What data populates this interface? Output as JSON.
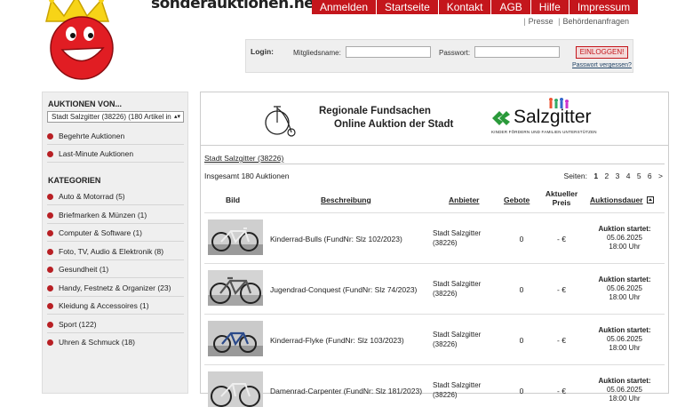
{
  "site": {
    "title": "sonderauktionen.net"
  },
  "nav": [
    {
      "label": "Anmelden"
    },
    {
      "label": "Startseite"
    },
    {
      "label": "Kontakt"
    },
    {
      "label": "AGB"
    },
    {
      "label": "Hilfe"
    },
    {
      "label": "Impressum"
    }
  ],
  "subnav": {
    "presse": "Presse",
    "behoerden": "Behördenanfragen"
  },
  "login": {
    "title": "Login:",
    "member_label": "Mitgliedsname:",
    "password_label": "Passwort:",
    "button": "EINLOGGEN!",
    "forgot": "Passwort vergessen?"
  },
  "sidebar": {
    "auctions_heading": "AUKTIONEN VON...",
    "selected_seller": "Stadt Salzgitter (38226) (180 Artikel in",
    "links": [
      {
        "label": "Begehrte Auktionen"
      },
      {
        "label": "Last-Minute Auktionen"
      }
    ],
    "categories_heading": "KATEGORIEN",
    "categories": [
      {
        "label": "Auto & Motorrad (5)"
      },
      {
        "label": "Briefmarken & Münzen (1)"
      },
      {
        "label": "Computer & Software (1)"
      },
      {
        "label": "Foto, TV, Audio & Elektronik (8)"
      },
      {
        "label": "Gesundheit (1)"
      },
      {
        "label": "Handy, Festnetz & Organizer (23)"
      },
      {
        "label": "Kleidung & Accessoires (1)"
      },
      {
        "label": "Sport (122)"
      },
      {
        "label": "Uhren & Schmuck (18)"
      }
    ]
  },
  "banner": {
    "line1": "Regionale Fundsachen",
    "line2": "Online Auktion der Stadt",
    "city_logo": "Salzgitter",
    "city_tagline": "KINDER FÖRDERN UND FAMILIEN UNTERSTÜTZEN"
  },
  "main": {
    "breadcrumb": "Stadt Salzgitter (38226)",
    "total": "Insgesamt 180 Auktionen",
    "pages_label": "Seiten:",
    "pages": [
      "1",
      "2",
      "3",
      "4",
      "5",
      "6",
      ">"
    ],
    "current_page": "1",
    "columns": {
      "bild": "Bild",
      "beschreibung": "Beschreibung",
      "anbieter": "Anbieter",
      "gebote": "Gebote",
      "preis": "Aktueller Preis",
      "dauer": "Auktionsdauer"
    },
    "rows": [
      {
        "desc": "Kinderrad-Bulls (FundNr: Slz 102/2023)",
        "seller": "Stadt Salzgitter",
        "seller_zip": "(38226)",
        "bids": "0",
        "price": "- €",
        "start_label": "Auktion startet:",
        "date": "05.06.2025",
        "time": "18:00 Uhr"
      },
      {
        "desc": "Jugendrad-Conquest (FundNr: Slz 74/2023)",
        "seller": "Stadt Salzgitter",
        "seller_zip": "(38226)",
        "bids": "0",
        "price": "- €",
        "start_label": "Auktion startet:",
        "date": "05.06.2025",
        "time": "18:00 Uhr"
      },
      {
        "desc": "Kinderrad-Flyke (FundNr: Slz 103/2023)",
        "seller": "Stadt Salzgitter",
        "seller_zip": "(38226)",
        "bids": "0",
        "price": "- €",
        "start_label": "Auktion startet:",
        "date": "05.06.2025",
        "time": "18:00 Uhr"
      },
      {
        "desc": "Damenrad-Carpenter (FundNr: Slz 181/2023)",
        "seller": "Stadt Salzgitter",
        "seller_zip": "(38226)",
        "bids": "0",
        "price": "- €",
        "start_label": "Auktion startet:",
        "date": "05.06.2025",
        "time": "18:00 Uhr"
      }
    ]
  },
  "colors": {
    "accent": "#c4161c",
    "sidebar_bg": "#efefef",
    "salzgitter_green": "#2a9a3a"
  }
}
